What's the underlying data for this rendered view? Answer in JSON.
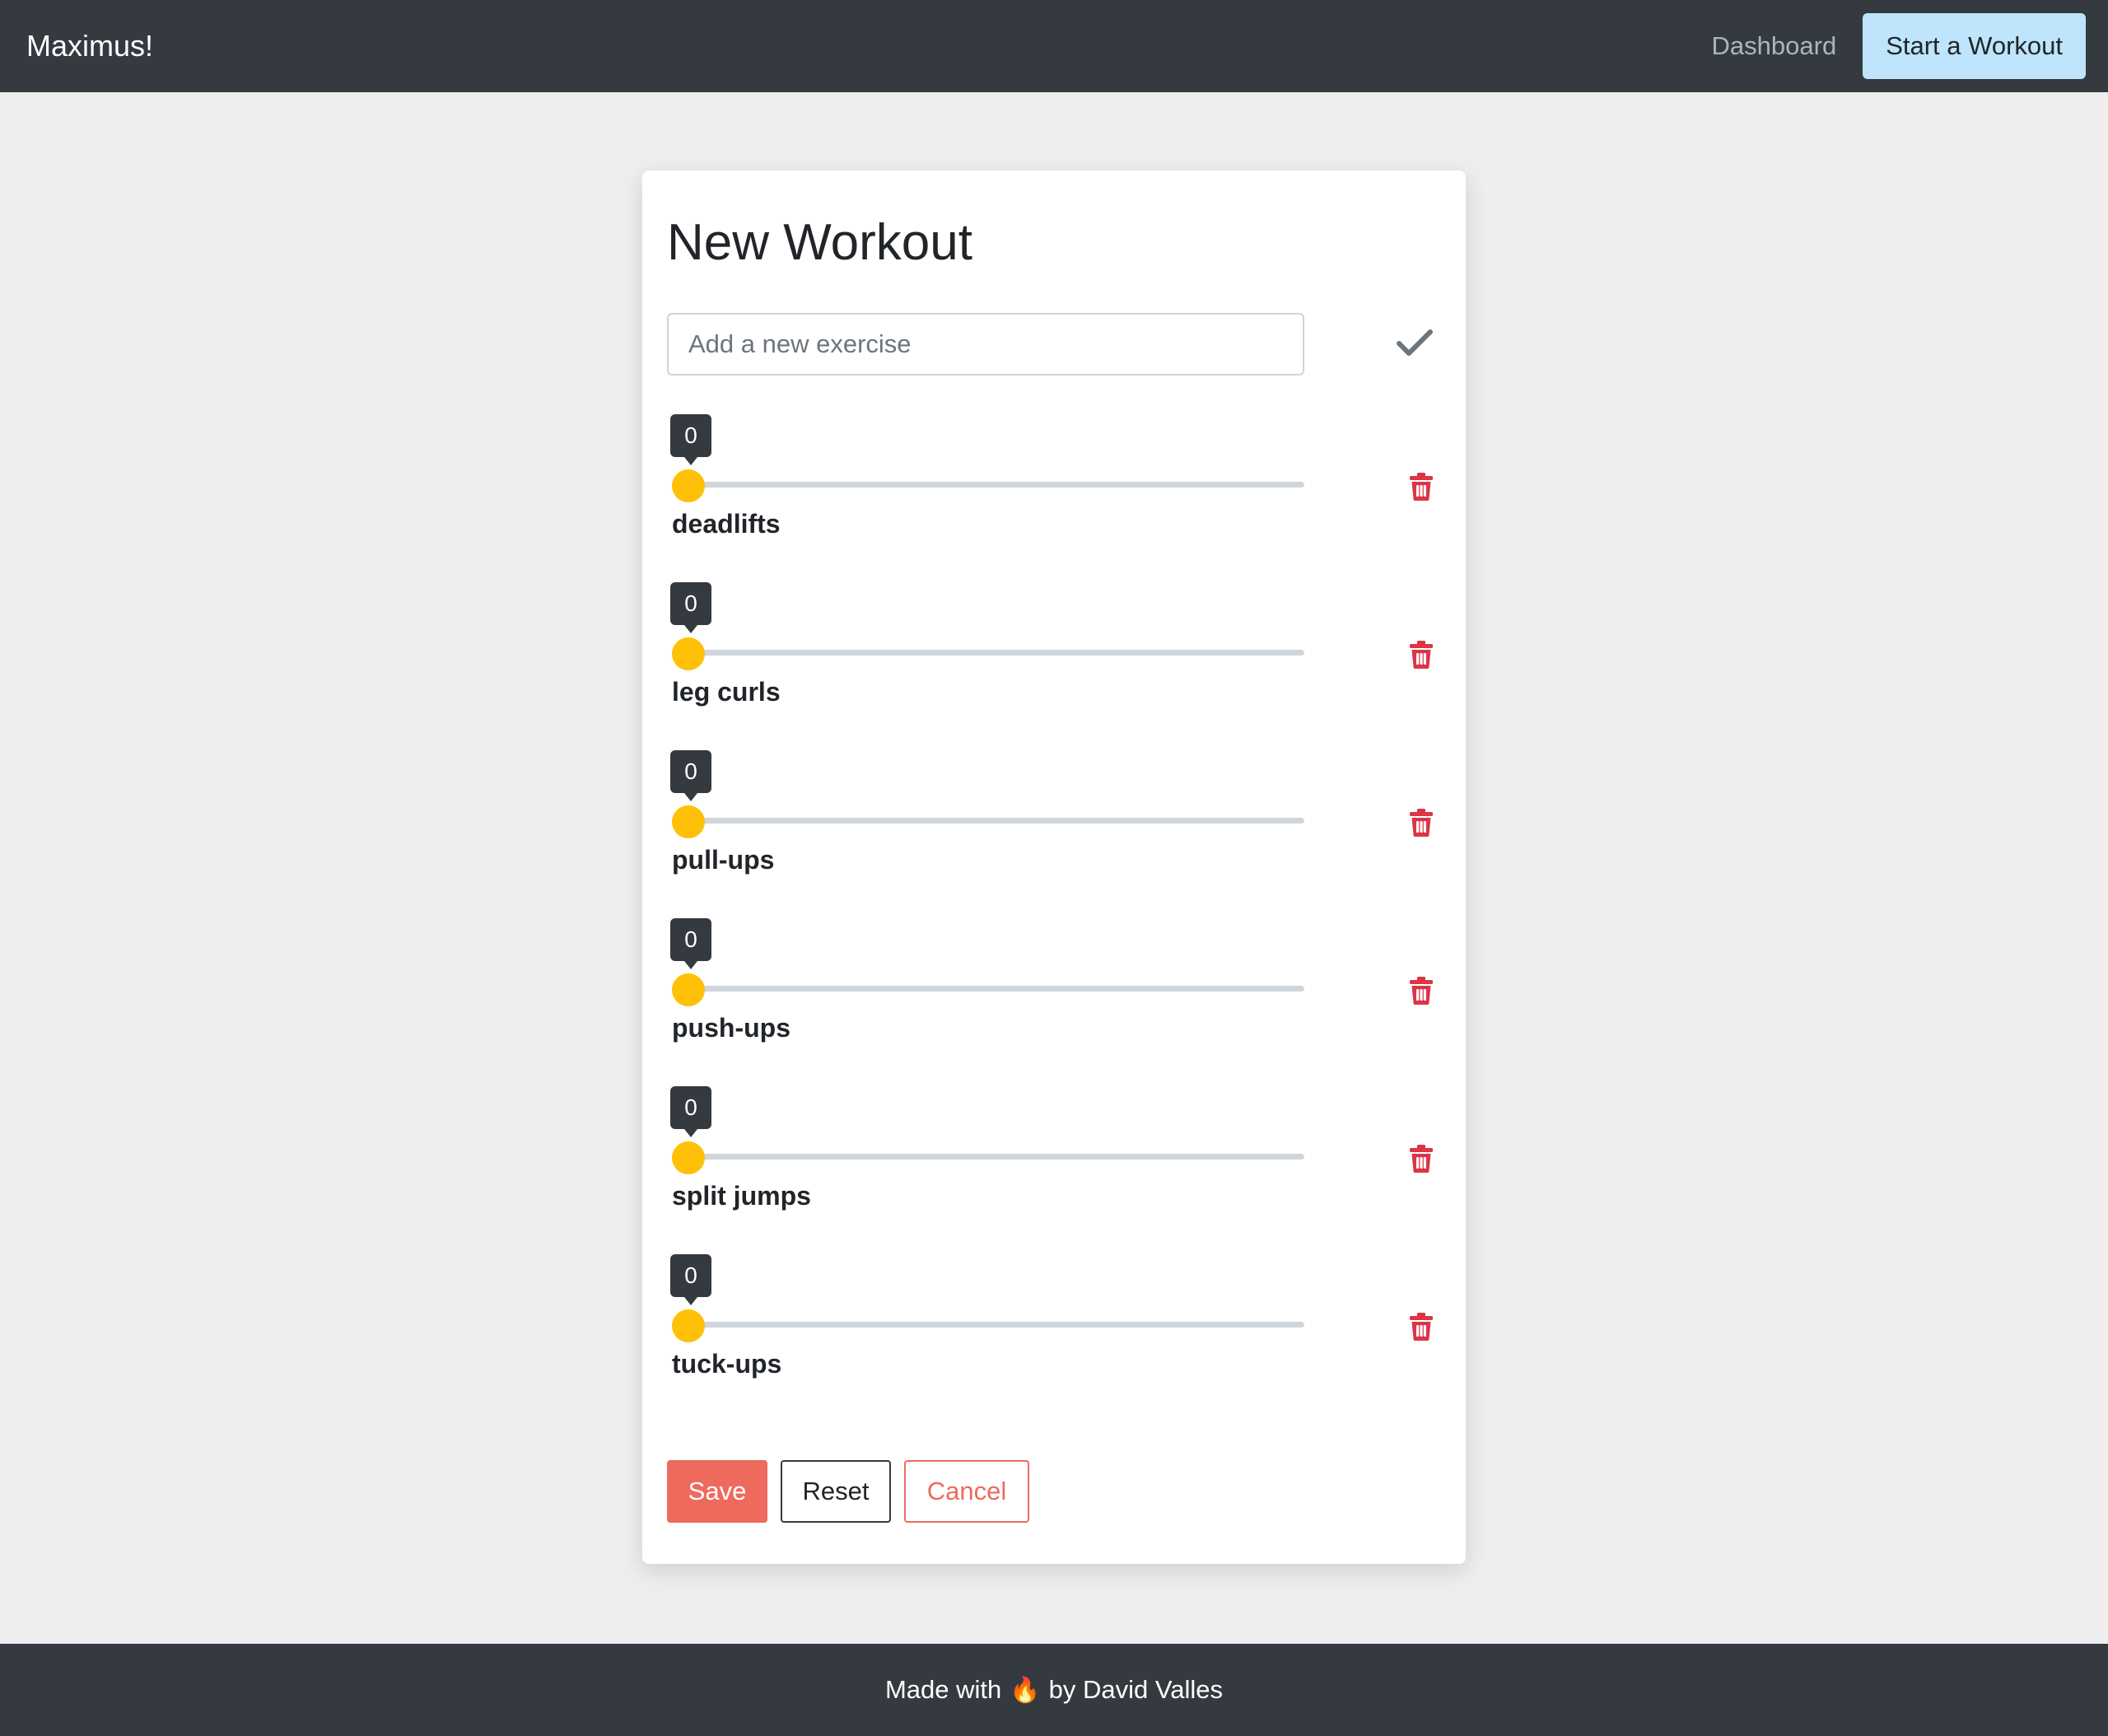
{
  "navbar": {
    "brand": "Maximus!",
    "dashboard_label": "Dashboard",
    "start_workout_label": "Start a Workout"
  },
  "card": {
    "title": "New Workout",
    "exercise_input": {
      "placeholder": "Add a new exercise",
      "value": ""
    },
    "confirm_icon": "checkmark-icon",
    "delete_icon": "trash-icon",
    "exercises": [
      {
        "name": "deadlifts",
        "value": "0"
      },
      {
        "name": "leg curls",
        "value": "0"
      },
      {
        "name": "pull-ups",
        "value": "0"
      },
      {
        "name": "push-ups",
        "value": "0"
      },
      {
        "name": "split jumps",
        "value": "0"
      },
      {
        "name": "tuck-ups",
        "value": "0"
      }
    ],
    "buttons": {
      "save": "Save",
      "reset": "Reset",
      "cancel": "Cancel"
    }
  },
  "footer": {
    "prefix": "Made with",
    "emoji": "🔥",
    "suffix": "by David Valles"
  },
  "colors": {
    "navbar_bg": "#343a40",
    "accent_yellow": "#ffc107",
    "danger_red": "#dc3545",
    "save_coral": "#ee6a5d",
    "cta_light_blue": "#bee5fb"
  }
}
